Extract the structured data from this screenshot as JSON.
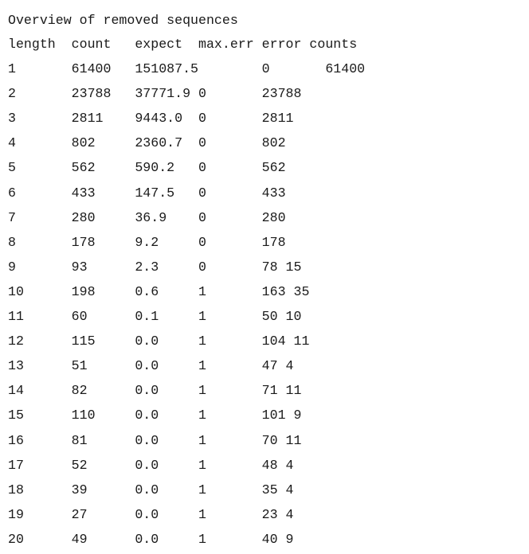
{
  "title": "Overview of removed sequences",
  "header": "length  count   expect  max.err error counts",
  "rows": [
    "1       61400   151087.5        0       61400",
    "2       23788   37771.9 0       23788",
    "3       2811    9443.0  0       2811",
    "4       802     2360.7  0       802",
    "5       562     590.2   0       562",
    "6       433     147.5   0       433",
    "7       280     36.9    0       280",
    "8       178     9.2     0       178",
    "9       93      2.3     0       78 15",
    "10      198     0.6     1       163 35",
    "11      60      0.1     1       50 10",
    "12      115     0.0     1       104 11",
    "13      51      0.0     1       47 4",
    "14      82      0.0     1       71 11",
    "15      110     0.0     1       101 9",
    "16      81      0.0     1       70 11",
    "17      52      0.0     1       48 4",
    "18      39      0.0     1       35 4",
    "19      27      0.0     1       23 4",
    "20      49      0.0     1       40 9"
  ]
}
